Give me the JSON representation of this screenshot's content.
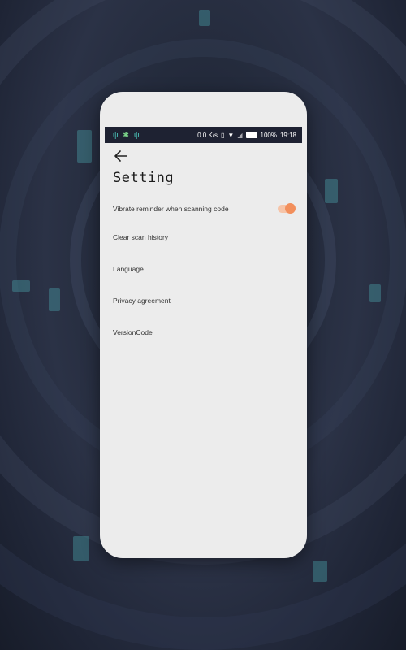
{
  "status_bar": {
    "left_icons": [
      "usb-icon",
      "notification-icon",
      "usb-icon"
    ],
    "speed": "0.0 K/s",
    "battery": "100%",
    "time": "19:18"
  },
  "header": {
    "back_icon": "arrow-left-icon",
    "title": "Setting"
  },
  "settings": {
    "items": [
      {
        "label": "Vibrate reminder when scanning code",
        "toggle_on": true
      },
      {
        "label": "Clear scan history"
      },
      {
        "label": "Language"
      },
      {
        "label": "Privacy agreement"
      },
      {
        "label": "VersionCode"
      }
    ]
  },
  "colors": {
    "accent": "#f28f5c",
    "toggle_track": "#f6c4a8",
    "status_bar_bg": "#1e2232",
    "screen_bg": "#ececec"
  }
}
